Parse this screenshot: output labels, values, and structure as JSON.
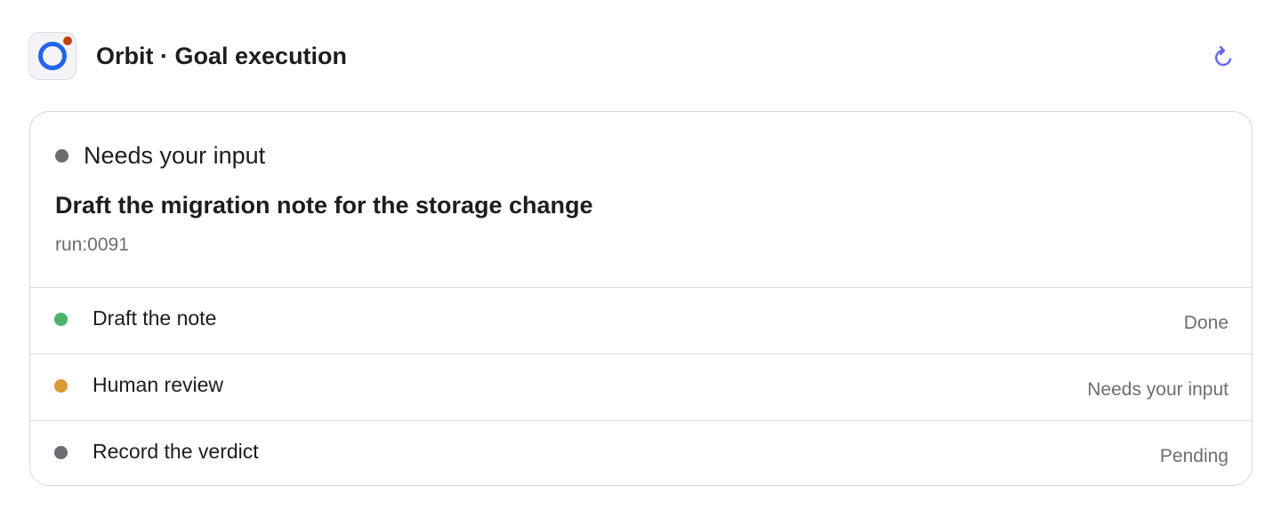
{
  "header": {
    "title": "Orbit · Goal execution",
    "app_icon": "orbit-logo-icon",
    "refresh_icon": "refresh-icon",
    "accent_color": "#2463eb",
    "refresh_color": "#6366f1"
  },
  "goal": {
    "status": "Needs your input",
    "status_color": "#6b6b70",
    "title": "Draft the migration note for the storage change",
    "run_id": "run:0091"
  },
  "steps": [
    {
      "label": "Draft the note",
      "status": "Done",
      "color": "#48b36b"
    },
    {
      "label": "Human review",
      "status": "Needs your input",
      "color": "#d99a32"
    },
    {
      "label": "Record the verdict",
      "status": "Pending",
      "color": "#6b6b70"
    }
  ]
}
